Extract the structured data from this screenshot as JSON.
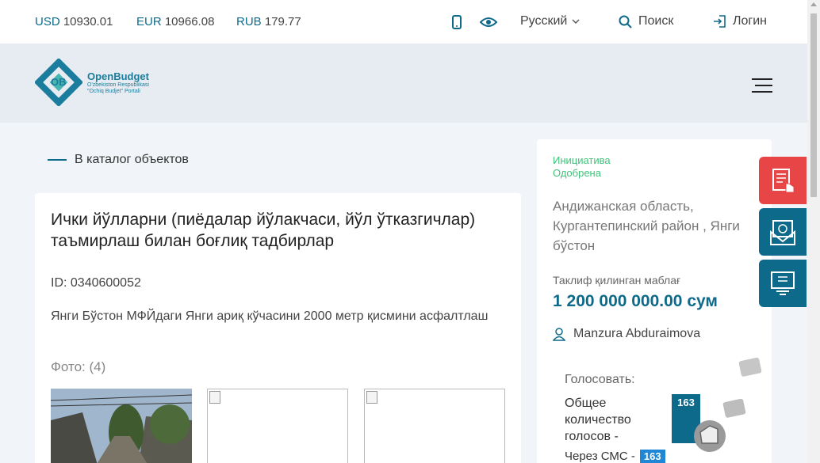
{
  "topbar": {
    "rates": [
      {
        "code": "USD",
        "value": "10930.01"
      },
      {
        "code": "EUR",
        "value": "10966.08"
      },
      {
        "code": "RUB",
        "value": "179.77"
      }
    ],
    "language": "Русский",
    "search_label": "Поиск",
    "login_label": "Логин"
  },
  "header": {
    "logo_title": "OpenBudget",
    "logo_sub1": "O'zbekiston Respublikasi",
    "logo_sub2": "\"Ochiq Budjet\" Portali"
  },
  "back_link": "В каталог объектов",
  "project": {
    "title": "Ички йўлларни (пиёдалар йўлакчаси, йўл ўтказгичлар) таъмирлаш билан боғлиқ тадбирлар",
    "id": "ID: 0340600052",
    "description": "Янги Бўстон МФЙдаги Янги ариқ кўчасини 2000 метр қисмини асфалтлаш",
    "photo_label": "Фото: (4)"
  },
  "side": {
    "status_line1": "Инициатива",
    "status_line2": "Одобрена",
    "region": "Андижанская область, Кургантепинский район , Янги бўстон",
    "amount_label": "Таклиф қилинган маблағ",
    "amount": "1 200 000 000.00 сум",
    "author": "Manzura Abduraimova",
    "vote_label": "Голосовать:",
    "vote_total_label": "Общее количество голосов -",
    "vote_total": "163",
    "sms_label": "Через СМС -",
    "sms_count": "163"
  },
  "colors": {
    "accent": "#0e6a8a",
    "status_green": "#3ec47a",
    "float_red": "#e84646"
  }
}
